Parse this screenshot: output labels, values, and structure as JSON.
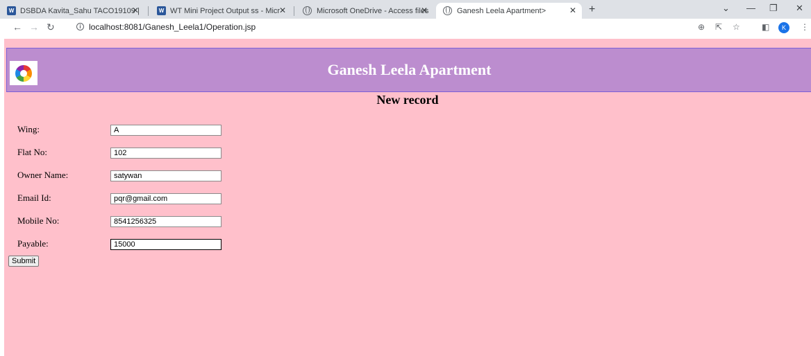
{
  "browser": {
    "tabs": [
      {
        "title": "DSBDA Kavita_Sahu TACO19109 |",
        "icon": "word-icon"
      },
      {
        "title": "WT Mini Project Output ss - Micr",
        "icon": "word-icon"
      },
      {
        "title": "Microsoft OneDrive - Access files",
        "icon": "globe-icon"
      },
      {
        "title": "Ganesh Leela Apartment>",
        "icon": "globe-icon",
        "active": true
      }
    ],
    "url": "localhost:8081/Ganesh_Leela1/Operation.jsp",
    "profile_initial": "K"
  },
  "page": {
    "site_title": "Ganesh Leela Apartment",
    "form_title": "New record",
    "fields": [
      {
        "label": "Wing:",
        "value": "A"
      },
      {
        "label": "Flat No:",
        "value": "102"
      },
      {
        "label": "Owner Name:",
        "value": "satywan"
      },
      {
        "label": "Email Id:",
        "value": "pqr@gmail.com"
      },
      {
        "label": "Mobile No:",
        "value": "8541256325"
      },
      {
        "label": "Payable:",
        "value": "15000"
      }
    ],
    "submit_label": "Submit",
    "colors": {
      "background": "#ffc0cb",
      "header": "#bc8dcf",
      "header_text": "#ffffff"
    }
  }
}
